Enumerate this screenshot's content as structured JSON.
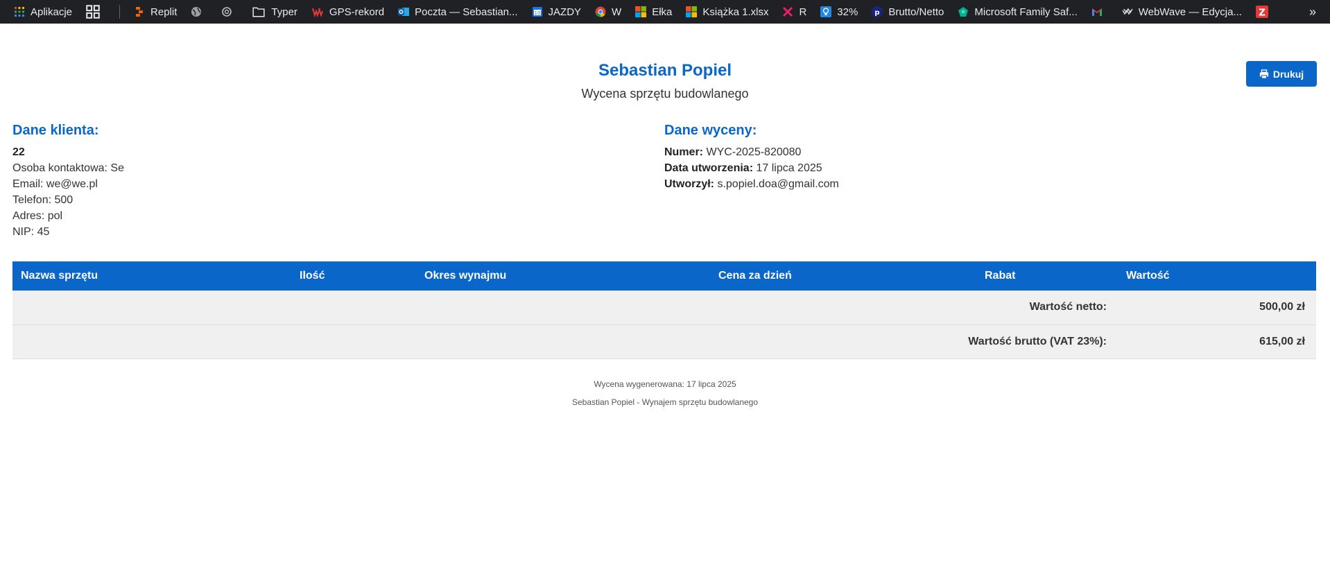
{
  "bookmarks": [
    {
      "label": "Aplikacje",
      "icon": "apps-grid-icon"
    },
    {
      "label": "",
      "icon": "grid-icon"
    },
    {
      "label": "Replit",
      "icon": "replit-icon"
    },
    {
      "label": "",
      "icon": "globe-icon"
    },
    {
      "label": "",
      "icon": "openai-icon"
    },
    {
      "label": "Typer",
      "icon": "folder-icon"
    },
    {
      "label": "GPS-rekord",
      "icon": "gps-icon"
    },
    {
      "label": "Poczta — Sebastian...",
      "icon": "outlook-icon"
    },
    {
      "label": "JAZDY",
      "icon": "calendar-icon"
    },
    {
      "label": "W",
      "icon": "chrome-icon"
    },
    {
      "label": "Ełka",
      "icon": "microsoft-icon"
    },
    {
      "label": "Książka 1.xlsx",
      "icon": "microsoft-icon"
    },
    {
      "label": "R",
      "icon": "x-brand-icon"
    },
    {
      "label": "32%",
      "icon": "bulb-icon"
    },
    {
      "label": "Brutto/Netto",
      "icon": "p-brand-icon"
    },
    {
      "label": "Microsoft Family Saf...",
      "icon": "family-icon"
    },
    {
      "label": "",
      "icon": "gmail-icon"
    },
    {
      "label": "WebWave — Edycja...",
      "icon": "webwave-icon"
    },
    {
      "label": "",
      "icon": "z-brand-icon"
    }
  ],
  "more_label": "»",
  "header": {
    "title": "Sebastian Popiel",
    "subtitle": "Wycena sprzętu budowlanego",
    "print_label": "Drukuj"
  },
  "client": {
    "heading": "Dane klienta:",
    "name": "22",
    "contact": "Osoba kontaktowa: Se",
    "email": "Email: we@we.pl",
    "phone": "Telefon: 500",
    "address": "Adres: pol",
    "nip": "NIP: 45"
  },
  "quote": {
    "heading": "Dane wyceny:",
    "number_label": "Numer:",
    "number_value": " WYC-2025-820080",
    "date_label": "Data utworzenia:",
    "date_value": " 17 lipca 2025",
    "author_label": "Utworzył:",
    "author_value": " s.popiel.doa@gmail.com"
  },
  "table": {
    "columns": [
      "Nazwa sprzętu",
      "Ilość",
      "Okres wynajmu",
      "Cena za dzień",
      "Rabat",
      "Wartość"
    ],
    "net_label": "Wartość netto:",
    "net_value": "500,00 zł",
    "gross_label": "Wartość brutto (VAT 23%):",
    "gross_value": "615,00 zł"
  },
  "footer": {
    "generated": "Wycena wygenerowana: 17 lipca 2025",
    "company": "Sebastian Popiel - Wynajem sprzętu budowlanego"
  },
  "colors": {
    "accent": "#0a66c8",
    "bar": "#202124",
    "row": "#f0f0f0"
  }
}
